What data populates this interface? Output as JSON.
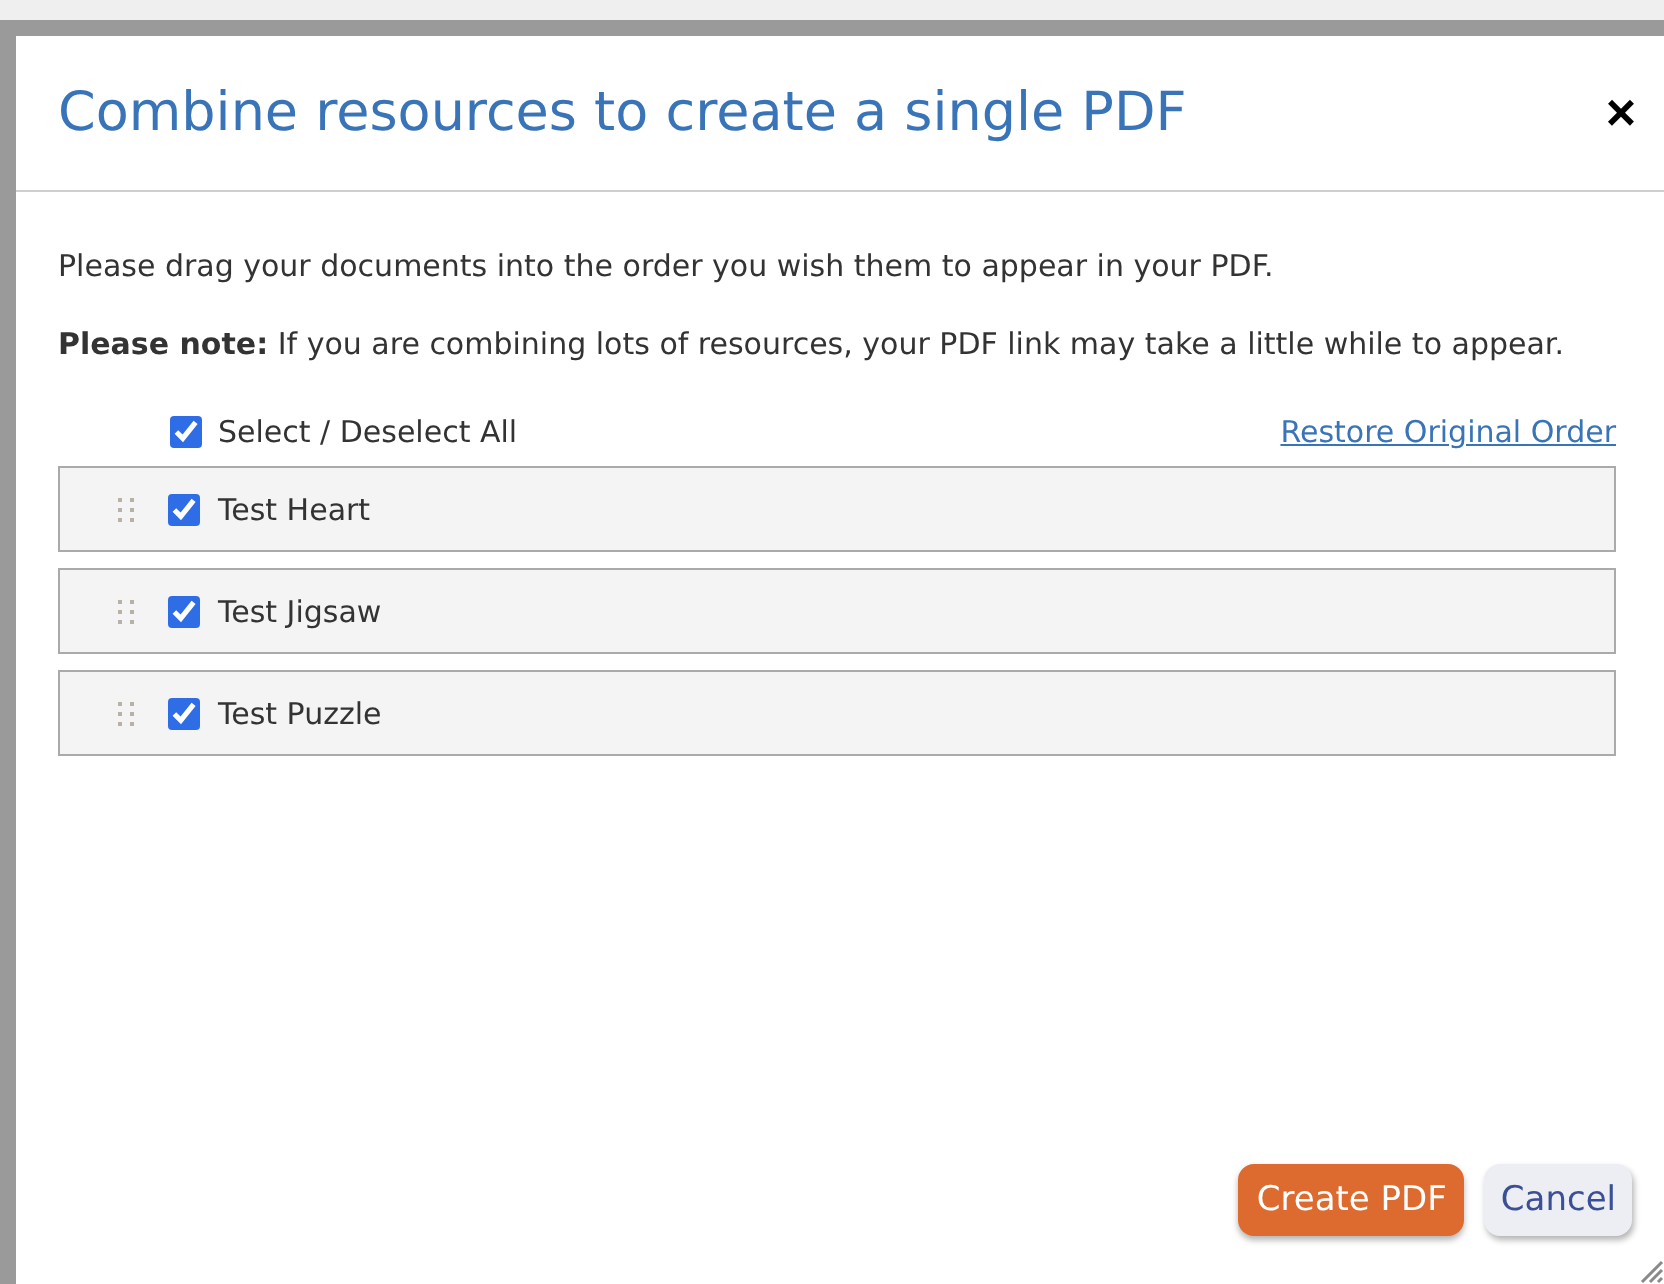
{
  "dialog": {
    "title": "Combine resources to create a single PDF",
    "close": "×"
  },
  "instructions": "Please drag your documents into the order you wish them to appear in your PDF.",
  "note": "**Please note:** If you are combining lots of resources, your PDF link may take a little while to appear.",
  "select_all": {
    "label": "Select / Deselect All",
    "checked": true
  },
  "restore_link": "Restore Original Order",
  "documents": [
    {
      "name": "Test Heart",
      "checked": true
    },
    {
      "name": "Test Jigsaw",
      "checked": true
    },
    {
      "name": "Test Puzzle",
      "checked": true
    }
  ],
  "buttons": {
    "primary": "Create PDF",
    "secondary": "Cancel"
  }
}
